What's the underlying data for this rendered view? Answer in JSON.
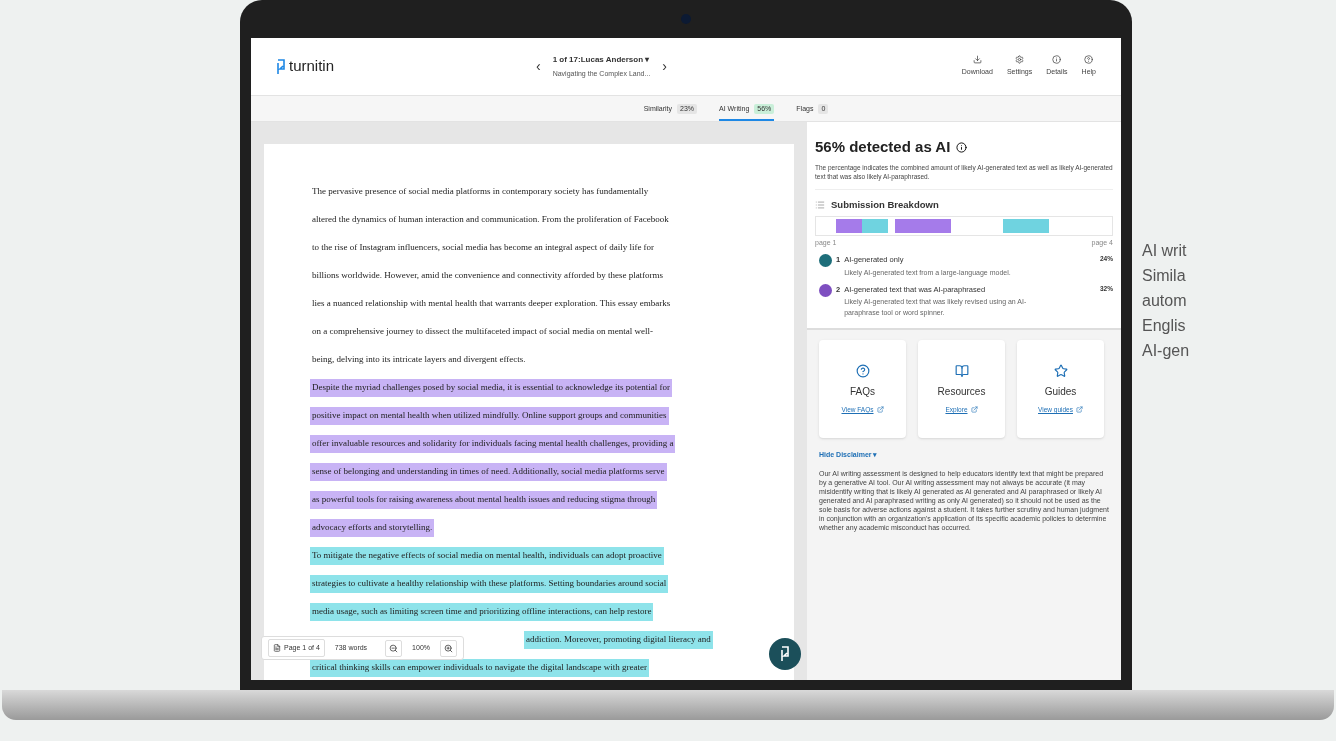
{
  "header": {
    "logo": "turnitin",
    "prev": "‹",
    "next": "›",
    "submission": "1 of 17:Lucas Anderson",
    "caret": "▾",
    "subtitle": "Navigating the Complex Land...",
    "actions": [
      {
        "kind": "download",
        "label": "Download"
      },
      {
        "kind": "settings",
        "label": "Settings"
      },
      {
        "kind": "details",
        "label": "Details"
      },
      {
        "kind": "help",
        "label": "Help"
      }
    ]
  },
  "tabs": [
    {
      "label": "Similarity",
      "badge": "23%",
      "selected": false
    },
    {
      "label": "AI Writing",
      "badge": "56%",
      "selected": true
    },
    {
      "label": "Flags",
      "badge": "0",
      "selected": false
    }
  ],
  "document": {
    "lines": [
      {
        "text": "The pervasive presence of social media platforms in contemporary society has fundamentally",
        "kind": "plain",
        "covered": false
      },
      {
        "text": "altered the dynamics of human interaction and communication. From the proliferation of Facebook",
        "kind": "plain",
        "covered": false
      },
      {
        "text": "to the rise of Instagram influencers, social media has become an integral aspect of daily life for",
        "kind": "plain",
        "covered": false
      },
      {
        "text": "billions worldwide. However, amid the convenience and connectivity afforded by these platforms",
        "kind": "plain",
        "covered": false
      },
      {
        "text": "lies a nuanced relationship with mental health that warrants deeper exploration. This essay embarks",
        "kind": "plain",
        "covered": false
      },
      {
        "text": "on a comprehensive journey to dissect the multifaceted impact of social media on mental well-",
        "kind": "plain",
        "covered": false
      },
      {
        "text": "being, delving into its intricate layers and divergent effects.",
        "kind": "plain",
        "covered": false
      },
      {
        "text": "Despite the myriad challenges posed by social media, it is essential to acknowledge its potential for",
        "kind": "paraphrased",
        "covered": false
      },
      {
        "text": "positive impact on mental health when utilized mindfully. Online support groups and communities",
        "kind": "paraphrased",
        "covered": false
      },
      {
        "text": "offer invaluable resources and solidarity for individuals facing mental health challenges, providing a",
        "kind": "paraphrased",
        "covered": false
      },
      {
        "text": "sense of belonging and understanding in times of need. Additionally, social media platforms serve",
        "kind": "paraphrased",
        "covered": false
      },
      {
        "text": "as powerful tools for raising awareness about mental health issues and reducing stigma through",
        "kind": "paraphrased",
        "covered": false
      },
      {
        "text": "advocacy efforts and storytelling.",
        "kind": "paraphrased",
        "covered": false
      },
      {
        "text": "To mitigate the negative effects of social media on mental health, individuals can adopt proactive",
        "kind": "generated",
        "covered": false
      },
      {
        "text": "strategies to cultivate a healthy relationship with these platforms. Setting boundaries around social",
        "kind": "generated",
        "covered": false
      },
      {
        "text": "media usage, such as limiting screen time and prioritizing offline interactions, can help restore",
        "kind": "generated",
        "covered": false
      },
      {
        "text": "addiction. Moreover, promoting digital literacy and",
        "kind": "generated",
        "covered": true
      },
      {
        "text": "critical thinking skills can empower individuals to navigate the digital landscape with greater",
        "kind": "generated",
        "covered": false
      }
    ],
    "toolbar": {
      "page": "Page 1 of 4",
      "words": "738 words",
      "zoom": "100%"
    }
  },
  "panel": {
    "title": "56% detected as AI",
    "description": "The percentage indicates the combined amount of likely AI-generated text as well as likely AI-generated text that was also likely AI-paraphrased.",
    "breakdown_title": "Submission Breakdown",
    "start_label": "page 1",
    "end_label": "page 4",
    "categories": [
      {
        "number": "1",
        "title": "AI-generated only",
        "description": "Likely AI-generated text from a large-language model.",
        "percent": "24%",
        "color": "#1e6e7a"
      },
      {
        "number": "2",
        "title": "AI-generated text that was AI-paraphrased",
        "description": "Likely AI-generated text that was likely revised using an AI-paraphrase tool or word spinner.",
        "percent": "32%",
        "color": "#7e4fc0"
      }
    ],
    "cards": [
      {
        "kind": "faq",
        "title": "FAQs",
        "link": "View FAQs"
      },
      {
        "kind": "resources",
        "title": "Resources",
        "link": "Explore"
      },
      {
        "kind": "guides",
        "title": "Guides",
        "link": "View guides"
      }
    ],
    "disclaimer_toggle": "Hide Disclaimer",
    "disclaimer_caret": "▾",
    "disclaimer": "Our AI writing assessment is designed to help educators identify text that might be prepared by a generative AI tool. Our AI writing assessment may not always be accurate (it may misidentify writing that is likely AI generated as AI generated and AI paraphrased or likely AI generated and AI paraphrased writing as only AI generated) so it should not be used as the sole basis for adverse actions against a student. It takes further scrutiny and human judgment in conjunction with an organization's application of its specific academic policies to determine whether any academic misconduct has occurred."
  },
  "side_text": [
    "AI writ",
    "Simila",
    "autom",
    "Englis",
    "AI-gen"
  ]
}
